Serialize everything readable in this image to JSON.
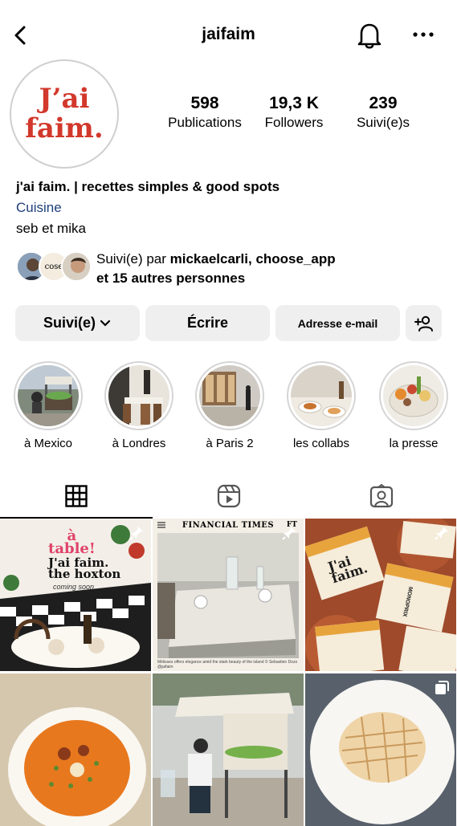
{
  "header": {
    "username": "jaifaim",
    "back_icon": "chevron-left-icon",
    "notify_icon": "bell-icon",
    "menu_icon": "more-horizontal-icon"
  },
  "profile": {
    "avatar_line1": "J’ai",
    "avatar_line2": "faim.",
    "brand_color": "#d2382b",
    "stats": [
      {
        "value": "598",
        "label": "Publications"
      },
      {
        "value": "19,3 K",
        "label": "Followers"
      },
      {
        "value": "239",
        "label": "Suivi(e)s"
      }
    ],
    "bio_name": "j'ai faim. | recettes simples & good spots",
    "category": "Cuisine",
    "bio_line": "seb et mika",
    "followed_prefix": "Suivi(e) par ",
    "followed_names": "mickaelcarli, choose_app",
    "followed_line2": "et 15 autres personnes",
    "follower_avatar_text": "cose"
  },
  "actions": {
    "follow": "Suivi(e)",
    "message": "Écrire",
    "email": "Adresse e-mail"
  },
  "highlights": [
    {
      "label": "à Mexico"
    },
    {
      "label": "à Londres"
    },
    {
      "label": "à Paris 2"
    },
    {
      "label": "les collabs"
    },
    {
      "label": "la presse"
    }
  ],
  "tabs": [
    "grid-icon",
    "reels-icon",
    "tagged-icon"
  ],
  "posts": {
    "p1_line1": "à",
    "p1_line2": "table!",
    "p1_line3": "J'ai faim.",
    "p1_line4": "the hoxton",
    "p1_line5": "coming soon",
    "p2_head": "FINANCIAL TIMES",
    "p2_logo": "FT",
    "p2_caption": "Mélisses offers elegance amid the stark beauty of the island © Sebastien Dozo @jaifaim",
    "p3_label1": "J'ai",
    "p3_label2": "faim.",
    "p3_brand": "MONOPRIX"
  }
}
